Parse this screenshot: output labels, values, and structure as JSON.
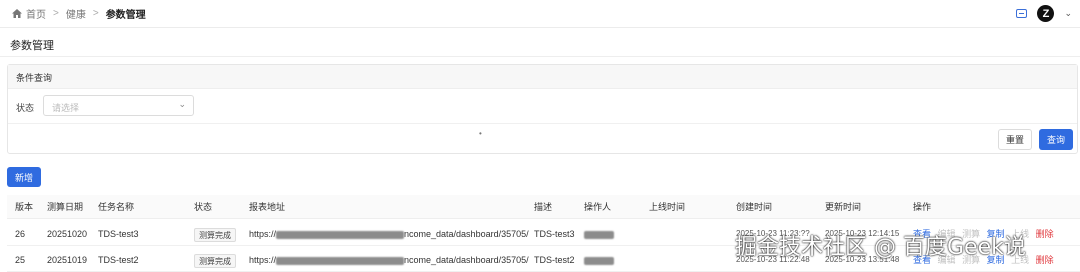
{
  "breadcrumb": {
    "home": "首页",
    "section": "健康",
    "current": "参数管理"
  },
  "header": {
    "avatar_letter": "Z"
  },
  "page": {
    "title": "参数管理"
  },
  "filter": {
    "title": "条件查询",
    "status_label": "状态",
    "status_placeholder": "请选择",
    "dot": "•",
    "reset_label": "重置",
    "query_label": "查询"
  },
  "toolbar": {
    "add_label": "新增"
  },
  "table": {
    "columns": [
      "版本",
      "测算日期",
      "任务名称",
      "状态",
      "报表地址",
      "描述",
      "操作人",
      "上线时间",
      "创建时间",
      "更新时间",
      "操作"
    ],
    "rows": [
      {
        "version": "26",
        "date": "20251020",
        "task": "TDS-test3",
        "status": "测算完成",
        "url_prefix": "https://",
        "url_suffix": "ncome_data/dashboard/35705/",
        "desc": "TDS-test3",
        "online": "",
        "created": "2025-10-23 11:23:??",
        "updated": "2025-10-23 12:14:15",
        "actions": [
          "查看",
          "编辑",
          "测算",
          "复制",
          "上线",
          "删除"
        ]
      },
      {
        "version": "25",
        "date": "20251019",
        "task": "TDS-test2",
        "status": "测算完成",
        "url_prefix": "https://",
        "url_suffix": "ncome_data/dashboard/35705/",
        "desc": "TDS-test2",
        "online": "",
        "created": "2025-10-23 11:22:48",
        "updated": "2025-10-23 13:51:48",
        "actions": [
          "查看",
          "编辑",
          "测算",
          "复制",
          "上线",
          "删除"
        ]
      }
    ]
  },
  "watermark": "掘金技术社区 @ 百度Geek说",
  "colors": {
    "primary": "#2f6be0",
    "danger": "#e0393e",
    "disabled": "#c0c0c0"
  }
}
